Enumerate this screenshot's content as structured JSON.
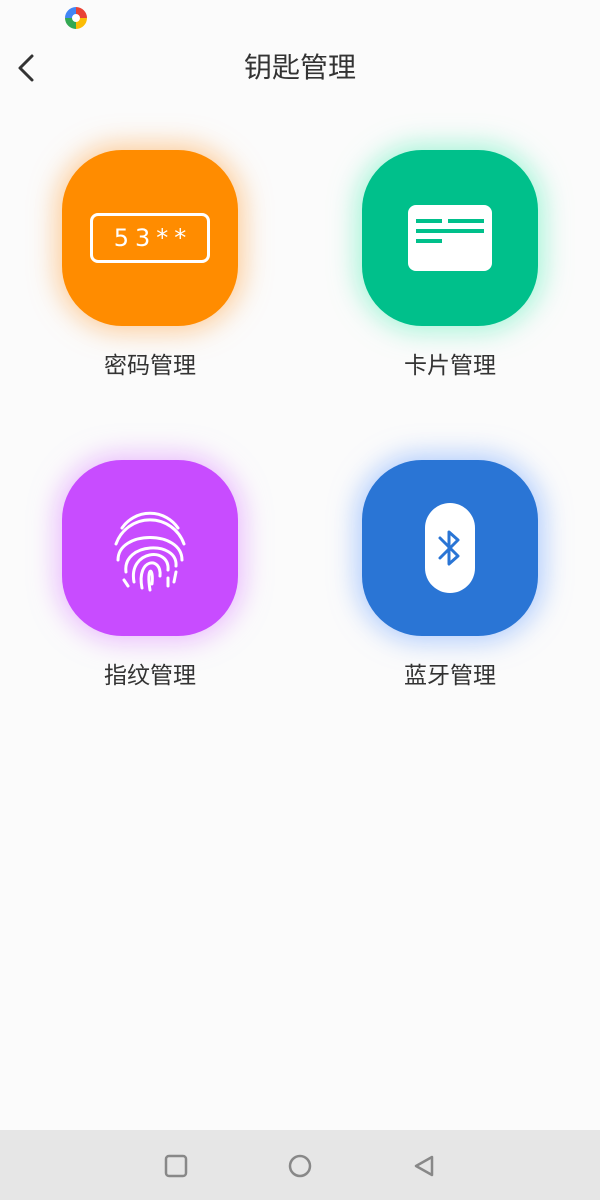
{
  "header": {
    "title": "钥匙管理",
    "back_icon": "chevron-left-icon"
  },
  "tiles": [
    {
      "label": "密码管理",
      "icon": "password-icon",
      "color": "#ff8c00",
      "glow": "#ffb266",
      "code": "53**"
    },
    {
      "label": "卡片管理",
      "icon": "card-icon",
      "color": "#00c08b",
      "glow": "#6ff0c2"
    },
    {
      "label": "指纹管理",
      "icon": "fingerprint-icon",
      "color": "#c84cff",
      "glow": "#e59cff"
    },
    {
      "label": "蓝牙管理",
      "icon": "bluetooth-icon",
      "color": "#2a75d5",
      "glow": "#86b3ff"
    }
  ],
  "nav": {
    "icons": [
      "square-icon",
      "circle-icon",
      "triangle-back-icon"
    ]
  },
  "status_bar": {
    "app_icon": "app-logo-icon"
  }
}
